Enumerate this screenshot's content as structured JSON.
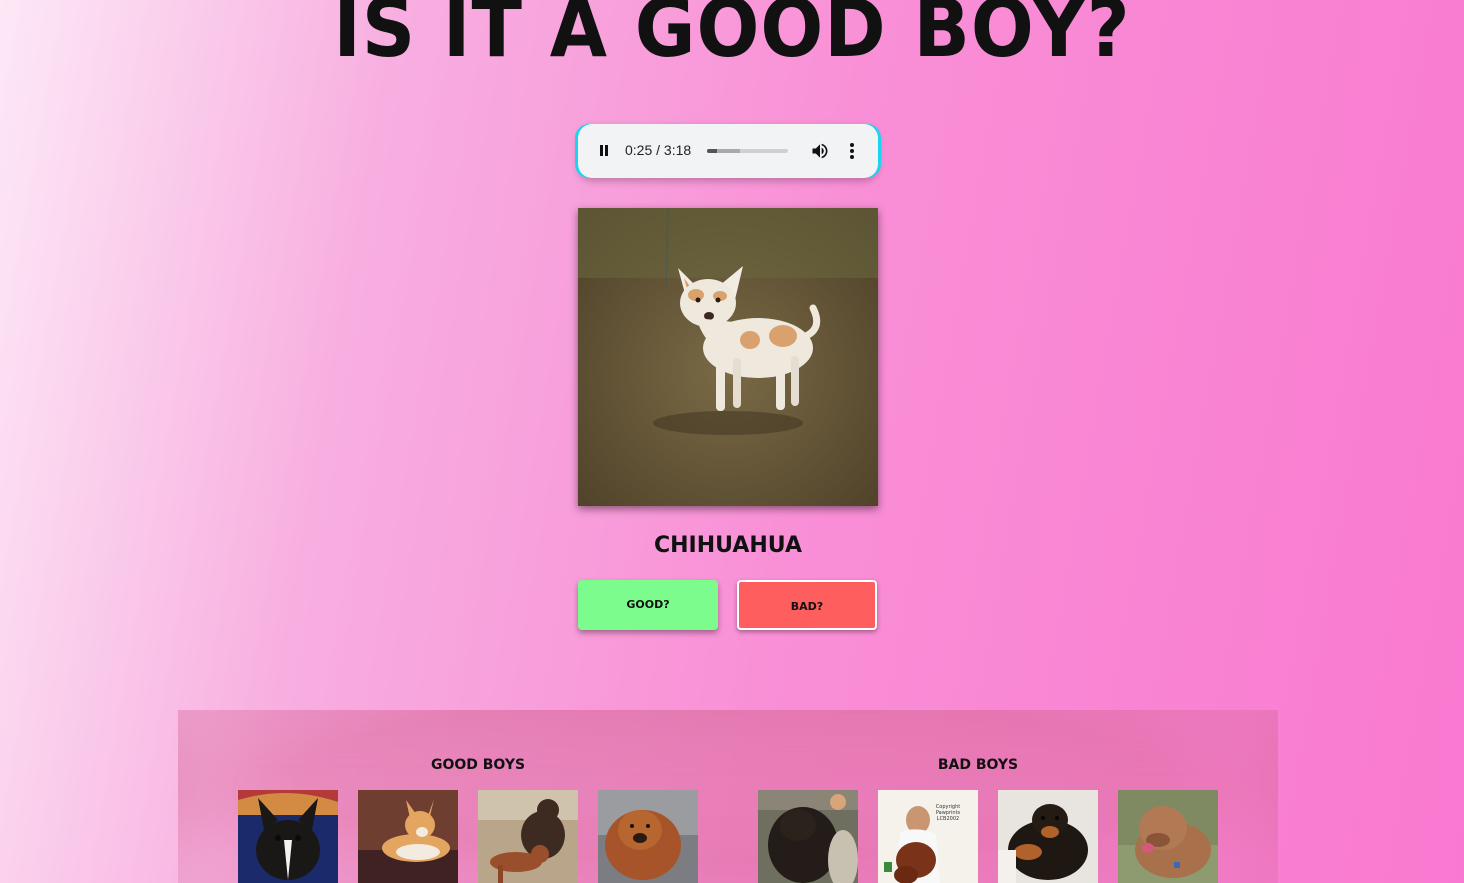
{
  "page": {
    "title": "Is it a Good Boy?"
  },
  "player": {
    "time_display": "0:25 / 3:18",
    "progress_fraction": 0.126,
    "buffered_fraction": 0.41
  },
  "current_dog": {
    "name": "chihuahua"
  },
  "buttons": {
    "good_label": "good?",
    "bad_label": "bad?"
  },
  "gallery": {
    "good_heading": "Good Boys",
    "bad_heading": "Bad Boys",
    "good_boys": [
      "french-bulldog",
      "corgi",
      "curly-coated-retriever-and-vizsla",
      "chow-chow"
    ],
    "bad_boys": [
      "curly-coated-retriever",
      "bloodhound",
      "rottweiler-mix",
      "dogue-de-bordeaux"
    ],
    "watermark_text": "Copyright Pawprints LCB2002"
  },
  "colors": {
    "good_button": "#7cfc8c",
    "bad_button": "#ff5e5e",
    "player_accent": "#1ad3ee"
  }
}
